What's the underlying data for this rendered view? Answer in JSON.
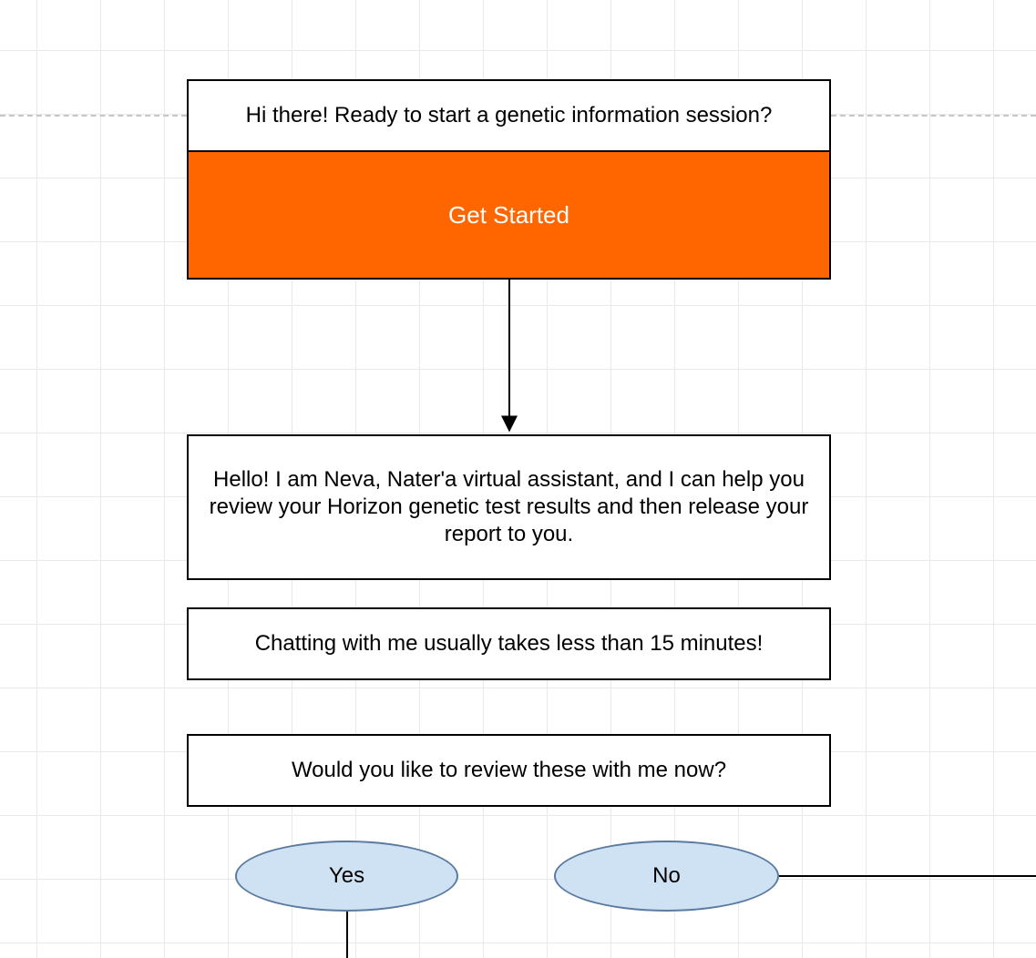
{
  "nodes": {
    "intro": "Hi there! Ready to start a genetic information session?",
    "get_started": "Get Started",
    "hello": "Hello!  I am Neva, Nater'a virtual assistant, and I can help you review your Horizon genetic test results and then release your report to you.",
    "duration": "Chatting with me usually takes less than 15 minutes!",
    "prompt": "Would you like to review these with me now?",
    "yes": "Yes",
    "no": "No"
  },
  "colors": {
    "accent": "#ff6600",
    "ellipse_fill": "#cfe2f3",
    "ellipse_stroke": "#5b7ba0"
  }
}
